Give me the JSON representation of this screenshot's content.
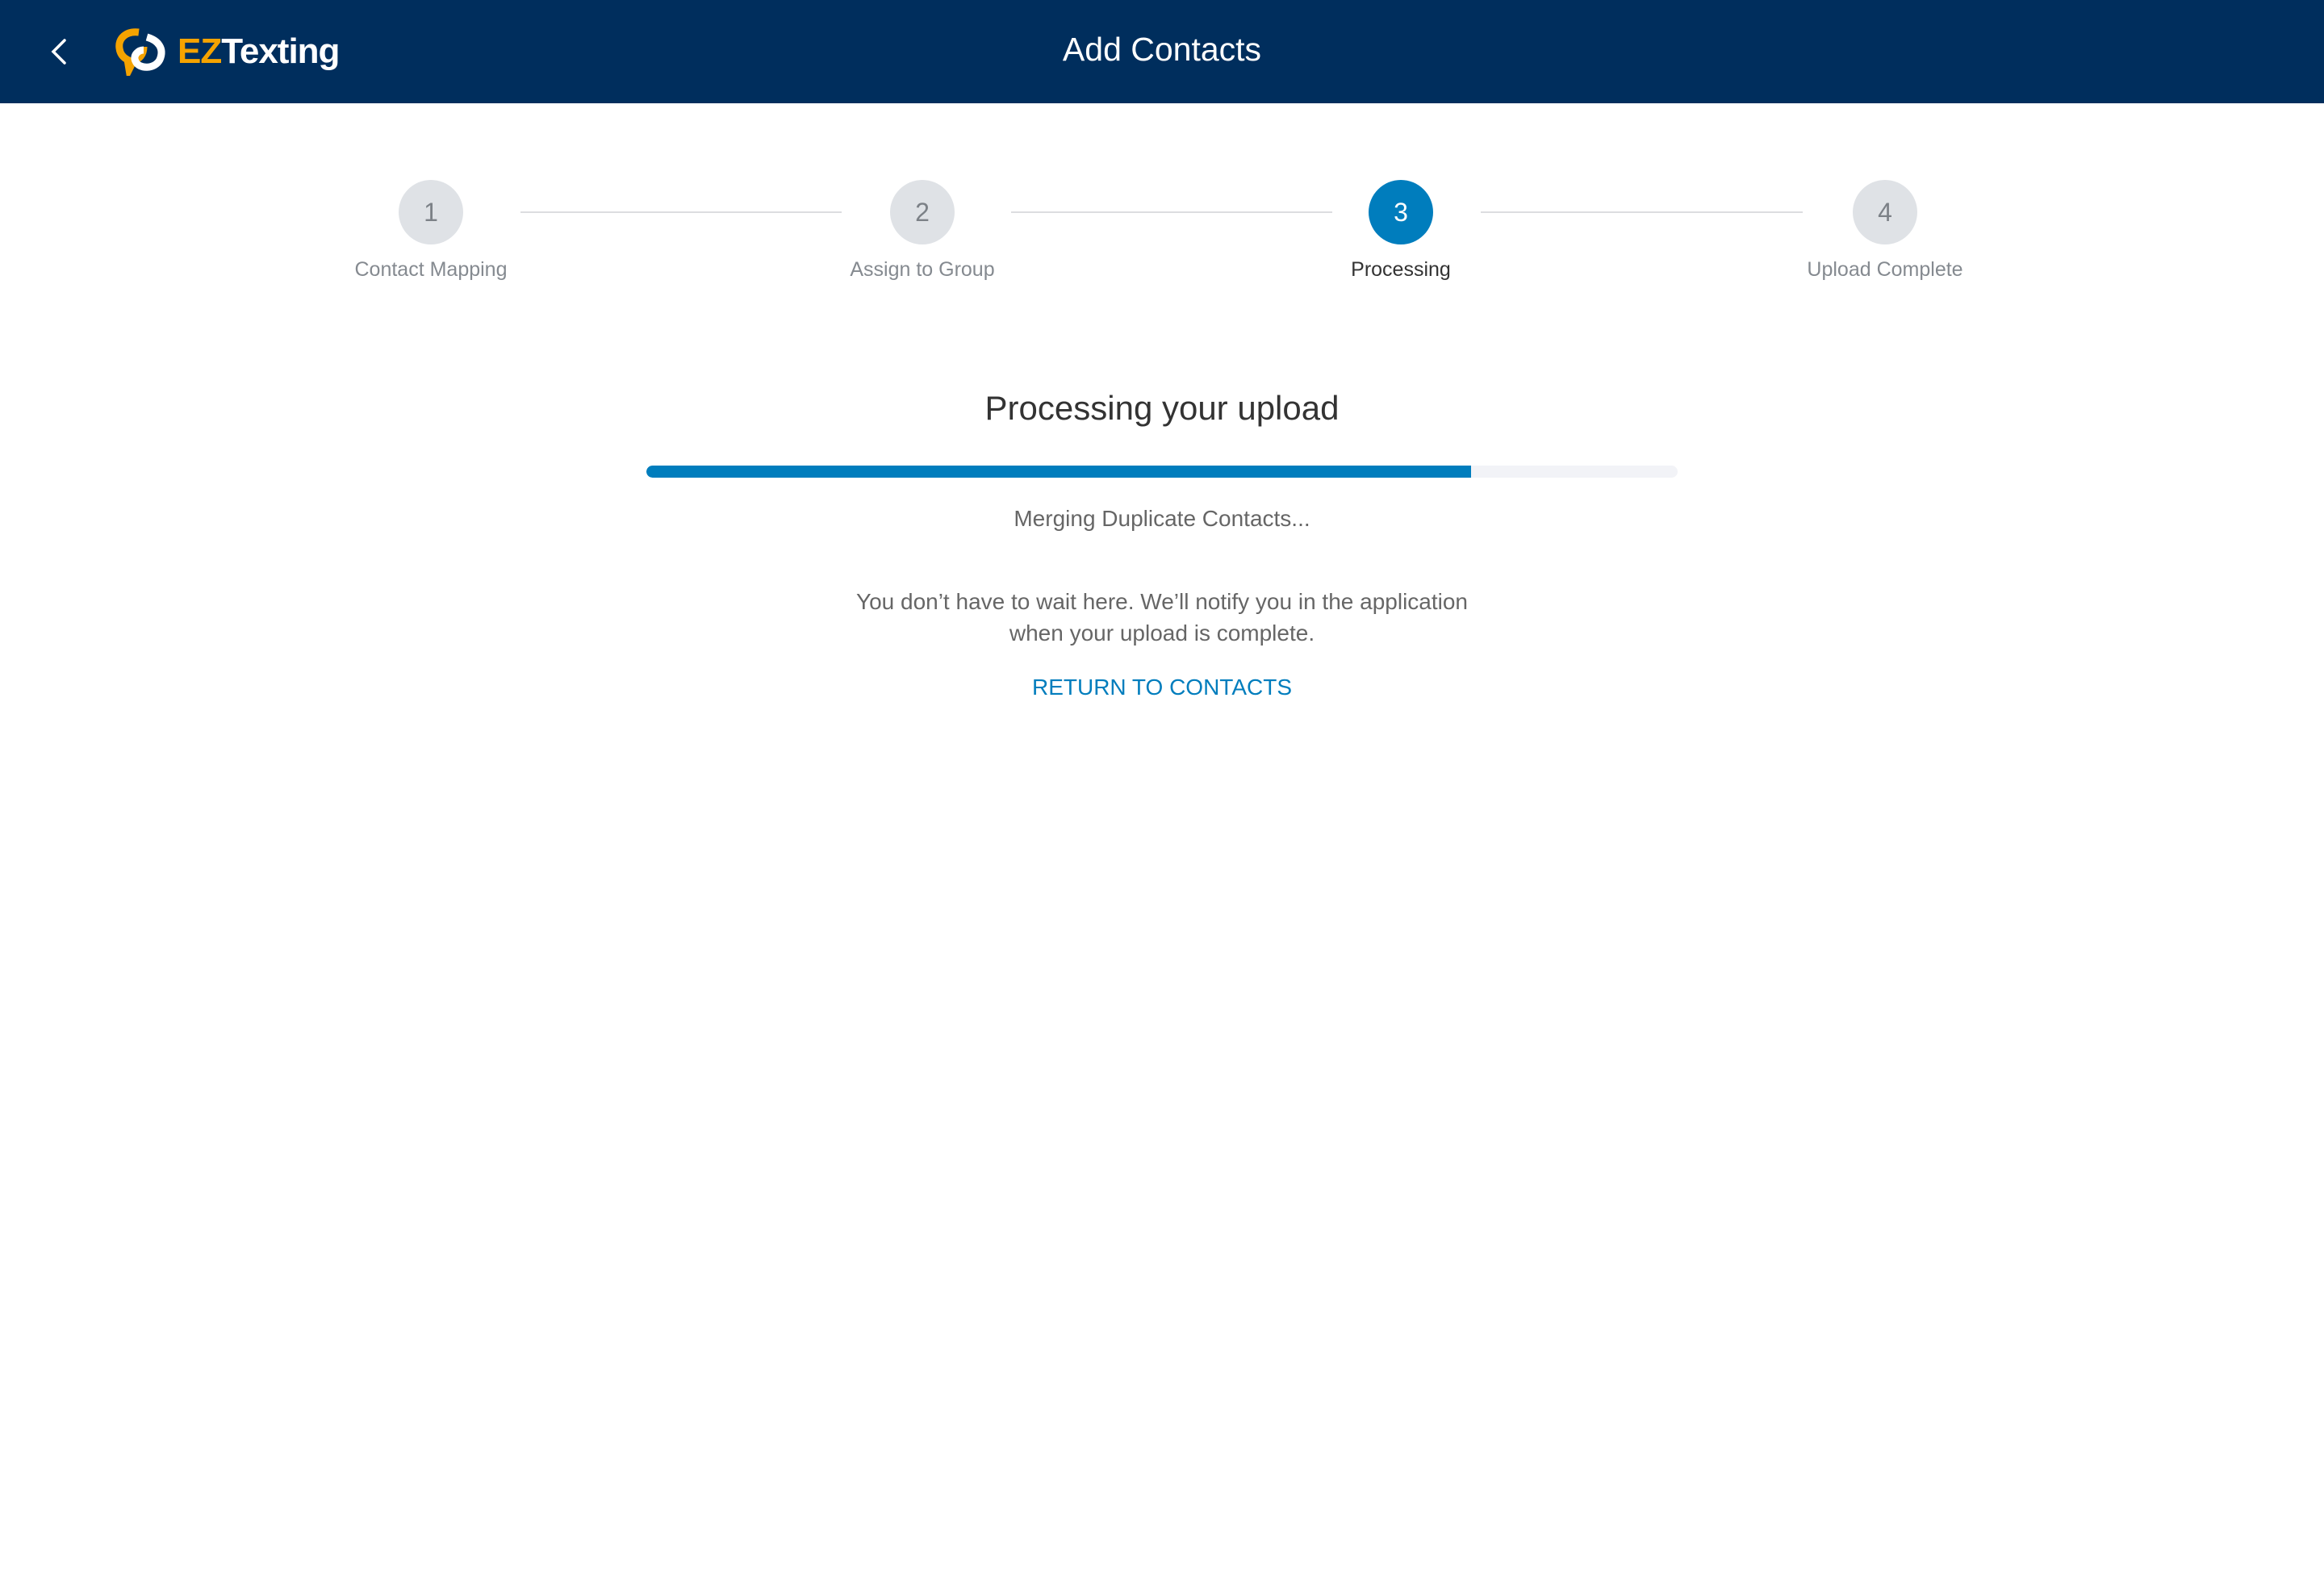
{
  "header": {
    "title": "Add Contacts",
    "logo_text_ez": "EZ",
    "logo_text_texting": "Texting",
    "colors": {
      "background": "#002e5d",
      "logo_accent": "#f5a300"
    }
  },
  "steps": [
    {
      "number": "1",
      "label": "Contact Mapping",
      "state": "inactive"
    },
    {
      "number": "2",
      "label": "Assign to Group",
      "state": "inactive"
    },
    {
      "number": "3",
      "label": "Processing",
      "state": "active"
    },
    {
      "number": "4",
      "label": "Upload Complete",
      "state": "inactive"
    }
  ],
  "main": {
    "heading": "Processing your upload",
    "progress_percent": 80,
    "status": "Merging Duplicate Contacts...",
    "note_line1": "You don’t have to wait here. We’ll notify you in the application",
    "note_line2": "when your upload is complete.",
    "return_link": "RETURN TO CONTACTS",
    "accent_color": "#007dbd"
  }
}
